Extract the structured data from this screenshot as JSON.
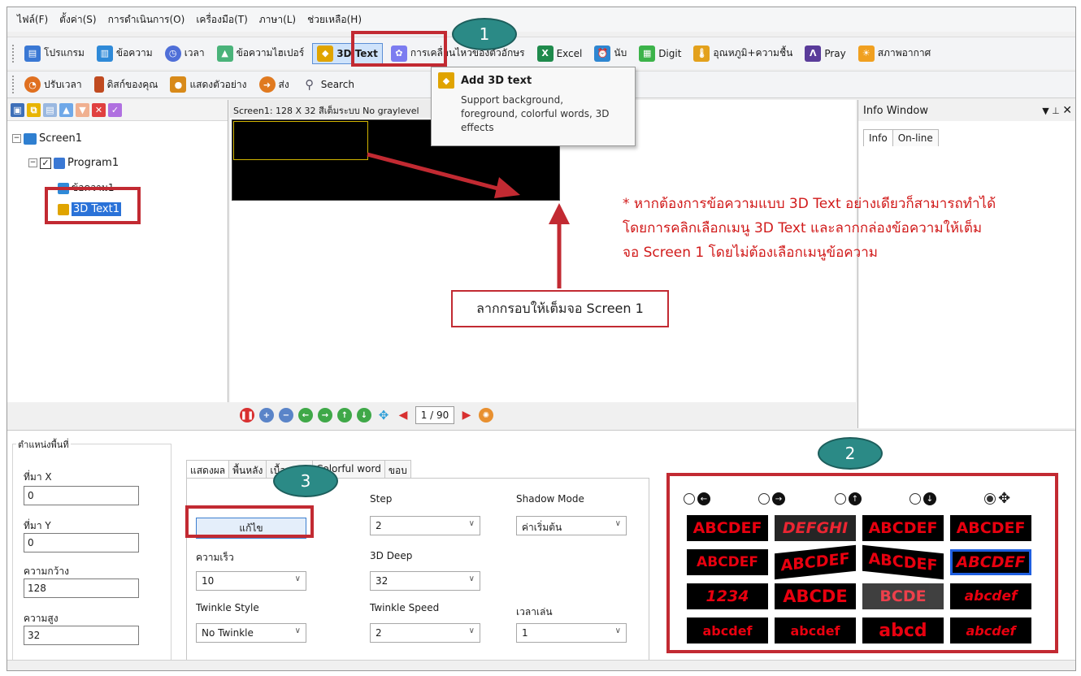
{
  "menu": [
    "ไฟล์(F)",
    "ตั้งค่า(S)",
    "การดำเนินการ(O)",
    "เครื่องมือ(T)",
    "ภาษา(L)",
    "ช่วยเหลือ(H)"
  ],
  "toolbar1": [
    {
      "label": "โปรแกรม",
      "icon": "program-icon",
      "color": "#3a78d4"
    },
    {
      "label": "ข้อความ",
      "icon": "book-icon",
      "color": "#2f8ad8"
    },
    {
      "label": "เวลา",
      "icon": "clock-icon",
      "color": "#4f6fd8"
    },
    {
      "label": "ข้อความไฮเปอร์",
      "icon": "picture-icon",
      "color": "#4ab37a"
    },
    {
      "label": "3D Text",
      "icon": "cube-icon",
      "color": "#e0a400"
    },
    {
      "label": "การเคลื่อนไหวของตัวอักษร",
      "icon": "flower-icon",
      "color": "#7c7cf0"
    },
    {
      "label": "Excel",
      "icon": "excel-icon",
      "color": "#1f8a4c"
    },
    {
      "label": "นับ",
      "icon": "alarm-icon",
      "color": "#2e86d1"
    },
    {
      "label": "Digit",
      "icon": "digit-icon",
      "color": "#3cb34a"
    },
    {
      "label": "อุณหภูมิ+ความชื้น",
      "icon": "thermometer-icon",
      "color": "#e3a11c"
    },
    {
      "label": "Pray",
      "icon": "pray-icon",
      "color": "#5a3c9a"
    },
    {
      "label": "สภาพอากาศ",
      "icon": "weather-icon",
      "color": "#f0a020"
    }
  ],
  "toolbar2": [
    {
      "label": "ปรับเวลา",
      "icon": "time-adjust-icon",
      "color": "#e07020"
    },
    {
      "label": "ดิสก์ของคุณ",
      "icon": "disk-icon",
      "color": "#c04a20"
    },
    {
      "label": "แสดงตัวอย่าง",
      "icon": "camera-icon",
      "color": "#d88a1a"
    },
    {
      "label": "ส่ง",
      "icon": "send-icon",
      "color": "#e07a20"
    },
    {
      "label": "Search",
      "icon": "search-icon",
      "color": "#7a8aa0"
    }
  ],
  "tooltip": {
    "title": "Add 3D text",
    "desc_line1": "Support background,",
    "desc_line2": "foreground, colorful words, 3D",
    "desc_line3": "effects"
  },
  "tree": {
    "screen": "Screen1",
    "program": "Program1",
    "text_item": "ข้อความ1",
    "selected_item": "3D Text1"
  },
  "canvas": {
    "header": "Screen1: 128 X 32  สีเต็มระบบ  No graylevel"
  },
  "playback": {
    "page": "1 / 90"
  },
  "info_window": {
    "title": "Info Window",
    "tabs": [
      "Info",
      "On-line"
    ]
  },
  "position": {
    "group_title": "ตำแหน่งพื้นที่",
    "x_label": "ที่มา X",
    "x_value": "0",
    "y_label": "ที่มา Y",
    "y_value": "0",
    "w_label": "ความกว้าง",
    "w_value": "128",
    "h_label": "ความสูง",
    "h_value": "32"
  },
  "tabs": [
    "แสดงผล",
    "พื้นหลัง",
    "เบื้องหน้า",
    "Colorful word",
    "ขอบ"
  ],
  "props": {
    "edit_button": "แก้ไข",
    "speed_label": "ความเร็ว",
    "speed_value": "10",
    "step_label": "Step",
    "step_value": "2",
    "deep_label": "3D Deep",
    "deep_value": "32",
    "shadow_label": "Shadow Mode",
    "shadow_value": "ค่าเริ่มต้น",
    "twinkle_style_label": "Twinkle Style",
    "twinkle_style_value": "No Twinkle",
    "twinkle_speed_label": "Twinkle Speed",
    "twinkle_speed_value": "2",
    "playtime_label": "เวลาเล่น",
    "playtime_value": "1"
  },
  "effects": {
    "directions": [
      "left",
      "right",
      "up",
      "down",
      "all"
    ],
    "selected_direction": "all",
    "thumbs": [
      "ABCDEF",
      "DEFGHI",
      "ABCDEF",
      "ABCDEF",
      "ABCDEF",
      "ABCDEF",
      "ABCDEF",
      "ABCDEF",
      "1234",
      "ABCDE",
      "BCDE",
      "abcdef",
      "abcdef",
      "abcdef",
      "abcd",
      "abcdef"
    ],
    "selected_thumb": 7
  },
  "annotations": {
    "callout1": "1",
    "callout2": "2",
    "callout3": "3",
    "drag_note": "ลากกรอบให้เต็มจอ Screen 1",
    "note_line1": "* หากต้องการข้อความแบบ 3D Text อย่างเดียวก็สามารถทำได้",
    "note_line2": "โดยการคลิกเลือกเมนู 3D Text และลากกล่องข้อความให้เต็ม",
    "note_line3": "จอ Screen 1 โดยไม่ต้องเลือกเมนูข้อความ"
  },
  "colors": {
    "annotation_red": "#c22a32",
    "callout_teal": "#2b8a86",
    "led_text": "#e8000f"
  }
}
